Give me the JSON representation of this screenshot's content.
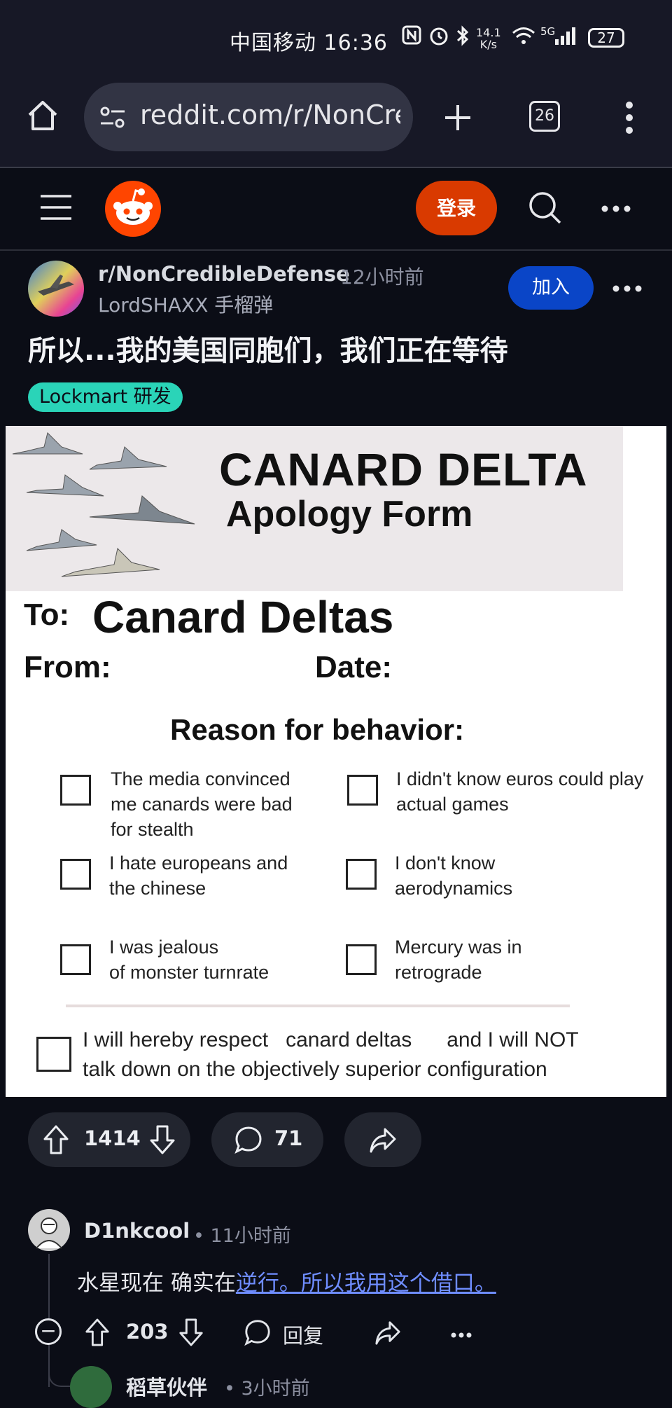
{
  "status_bar": {
    "time": "中国移动 16:36",
    "net_speed_value": "14.1",
    "net_speed_unit": "K/s",
    "network": "5G",
    "battery": "27",
    "icons": [
      "nfc-icon",
      "alarm-icon",
      "bluetooth-icon",
      "wifi-icon",
      "signal-icon",
      "battery-icon"
    ]
  },
  "browser": {
    "url": "reddit.com/r/NonCre",
    "tabs_count": "26"
  },
  "header": {
    "login_label": "登录"
  },
  "post": {
    "subreddit": "r/NonCredibleDefense",
    "time": "12小时前",
    "author": "LordSHAXX 手榴弹",
    "join_label": "加入",
    "title": "所以...我的美国同胞们，我们正在等待",
    "flair": "Lockmart 研发",
    "image": {
      "title_line1": "CANARD DELTA",
      "title_line2": "Apology Form",
      "to_label": "To:",
      "to_value": "Canard Deltas",
      "from_label": "From:",
      "date_label": "Date:",
      "reason_label": "Reason for behavior:",
      "reasons": [
        [
          "The media convinced",
          "me canards were bad",
          "for stealth"
        ],
        [
          "I didn't know euros could play",
          "actual games"
        ],
        [
          "I hate europeans and",
          "the chinese"
        ],
        [
          "I don't know",
          "aerodynamics"
        ],
        [
          "I was jealous",
          "of  monster turnrate"
        ],
        [
          "Mercury was in",
          "retrograde"
        ]
      ],
      "pledge_line1": "I will hereby respect   canard deltas      and I will NOT",
      "pledge_line2": "talk down on the objectively superior configuration"
    },
    "votes": "1414",
    "comments": "71"
  },
  "comment": {
    "user": "D1nkcool",
    "time": "• 11小时前",
    "body_plain": "水星现在 确实在",
    "body_link": "逆行。所以我用这个借口。",
    "votes": "203",
    "reply_label": "回复"
  },
  "next_comment": {
    "user": "稻草伙伴",
    "time": "• 3小时前"
  },
  "colors": {
    "background": "#0b0d16",
    "reddit_orange": "#ff4500",
    "login_button": "#d93a00",
    "join_button": "#0a45c7",
    "flair": "#2ad4b8",
    "link": "#6f8dff"
  }
}
